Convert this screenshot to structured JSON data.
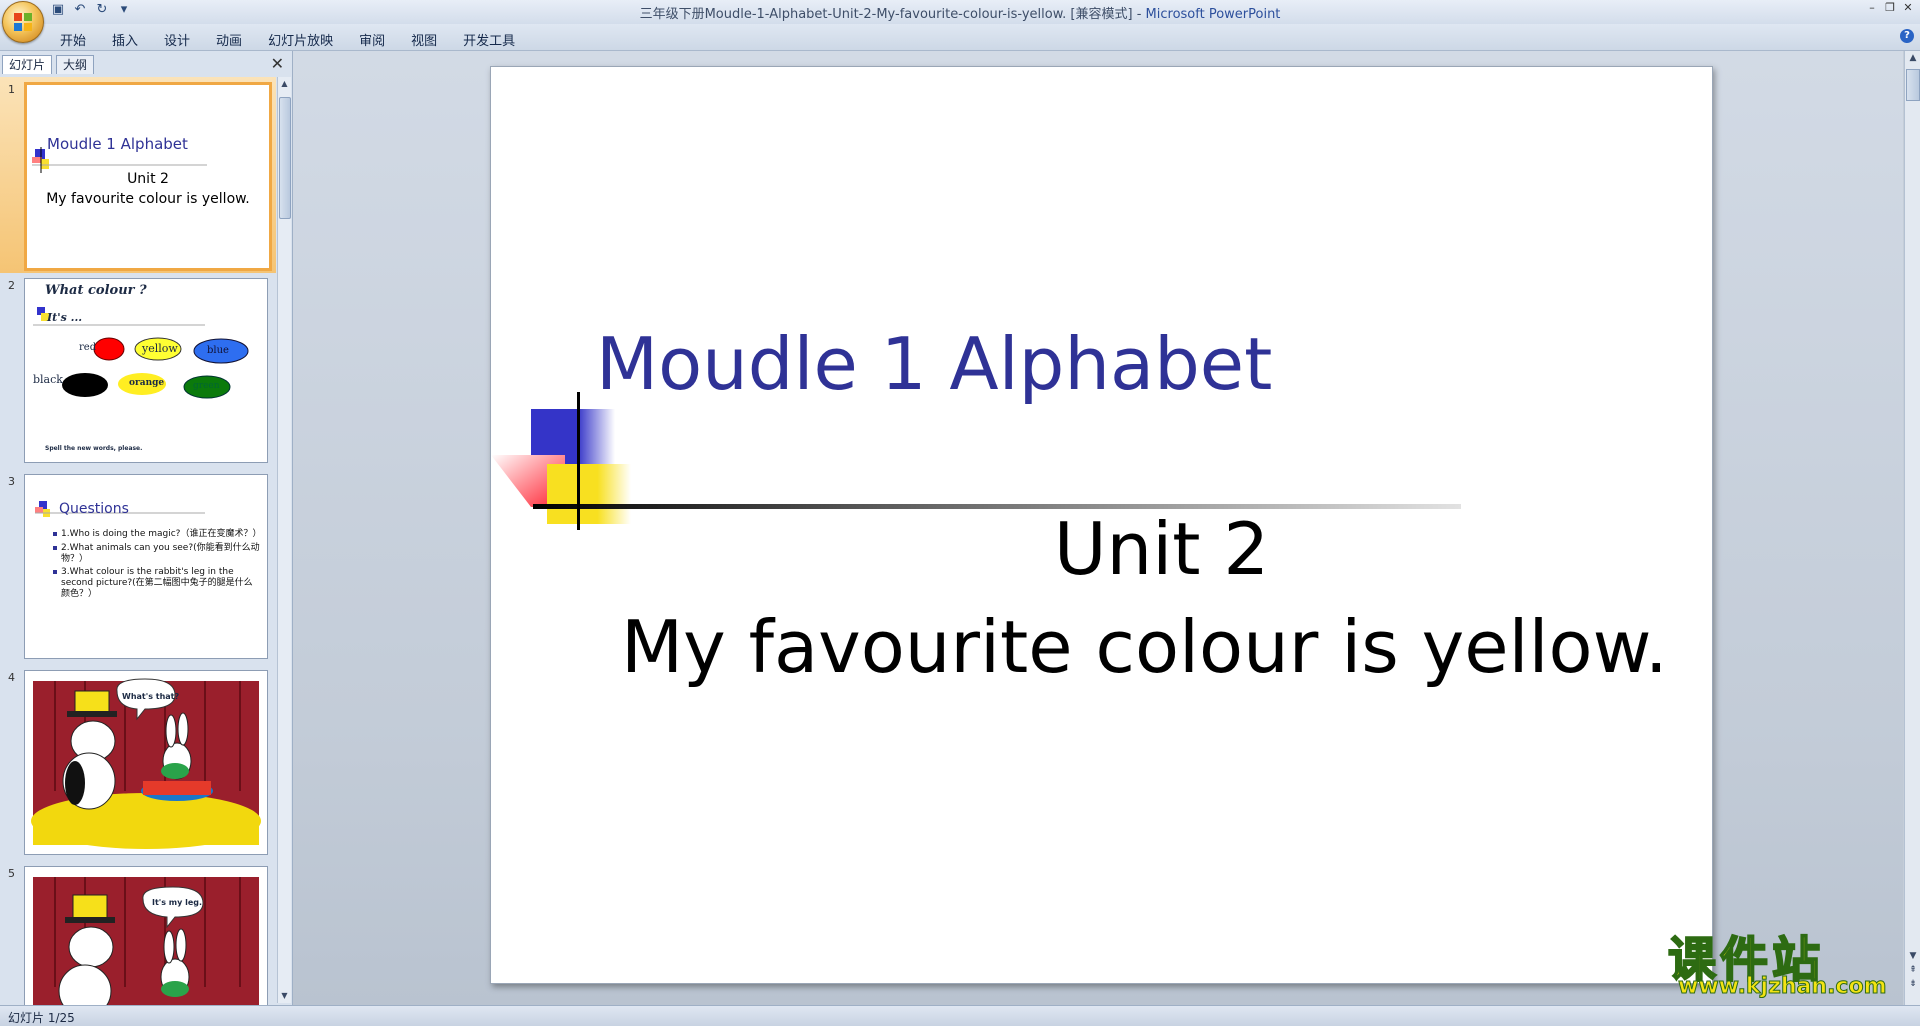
{
  "window": {
    "title": "三年级下册Moudle-1-Alphabet-Unit-2-My-favourite-colour-is-yellow. [兼容模式]",
    "app_name": "Microsoft PowerPoint"
  },
  "quick_access": [
    "save-icon",
    "undo-icon",
    "redo-icon",
    "customize-icon"
  ],
  "menu": [
    "开始",
    "插入",
    "设计",
    "动画",
    "幻灯片放映",
    "审阅",
    "视图",
    "开发工具"
  ],
  "panel": {
    "tabs": [
      "幻灯片",
      "大纲"
    ],
    "close_label": "✕"
  },
  "thumbnails": [
    {
      "num": "1",
      "title": "Moudle 1 Alphabet",
      "line1": "Unit  2",
      "line2": "My favourite colour is yellow."
    },
    {
      "num": "2",
      "heading": "What colour ?",
      "sub": "It's ...",
      "labels": [
        "red",
        "yellow",
        "blue",
        "black",
        "orange",
        "green"
      ],
      "footer": "Spell the new words, please."
    },
    {
      "num": "3",
      "heading": "Questions",
      "bullets": [
        "1.Who is doing the magic?（谁正在变魔术？）",
        "2.What animals can you see?(你能看到什么动物？）",
        "3.What colour  is the rabbit's leg in the second picture?(在第二幅图中兔子的腿是什么颜色？）"
      ]
    },
    {
      "num": "4",
      "bubble": "What's that?"
    },
    {
      "num": "5",
      "bubble": "It's my leg."
    }
  ],
  "slide": {
    "title": "Moudle 1 Alphabet",
    "subtitle1": "Unit  2",
    "subtitle2": "My favourite colour is yellow."
  },
  "status": {
    "slide_indicator": "幻灯片 1/25"
  },
  "watermark": {
    "cn": "课件站",
    "url": "www.kjzhan.com"
  },
  "colors": {
    "title_blue": "#2f3296",
    "accent_orange": "#f0a844"
  }
}
